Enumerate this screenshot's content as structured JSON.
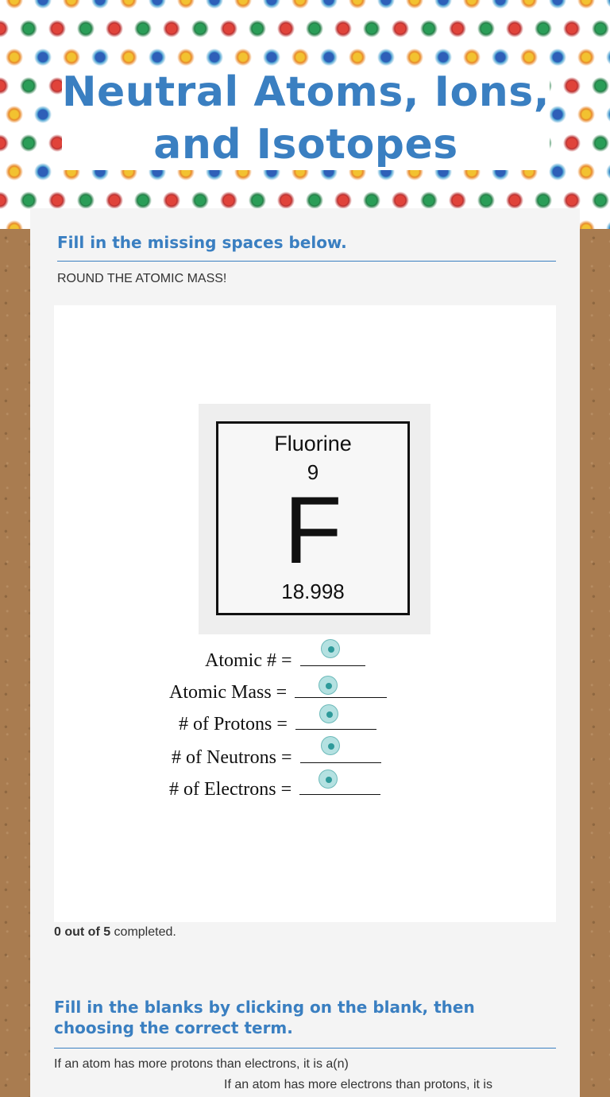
{
  "header": {
    "title_line1": "Neutral Atoms, Ions,",
    "title_line2": "and Isotopes"
  },
  "section1": {
    "heading": "Fill in the missing spaces below.",
    "instruction": "ROUND THE ATOMIC MASS!",
    "element": {
      "name": "Fluorine",
      "atomic_number": "9",
      "symbol": "F",
      "atomic_mass": "18.998"
    },
    "questions": [
      {
        "label": "Atomic # ="
      },
      {
        "label": "Atomic Mass ="
      },
      {
        "label": "# of Protons ="
      },
      {
        "label": "# of Neutrons ="
      },
      {
        "label": "# of Electrons ="
      }
    ],
    "progress": {
      "count_text": "0 out of 5",
      "suffix": " completed."
    }
  },
  "section2": {
    "heading": "Fill in the blanks by clicking on the blank, then choosing the correct term.",
    "line1": "If an atom has more protons than electrons, it is a(n)",
    "line2": "If an atom has more electrons than protons, it is"
  },
  "colors": {
    "accent": "#3a7fc1",
    "hotspot": "#76c8c8",
    "cardboard": "#a97c50"
  }
}
